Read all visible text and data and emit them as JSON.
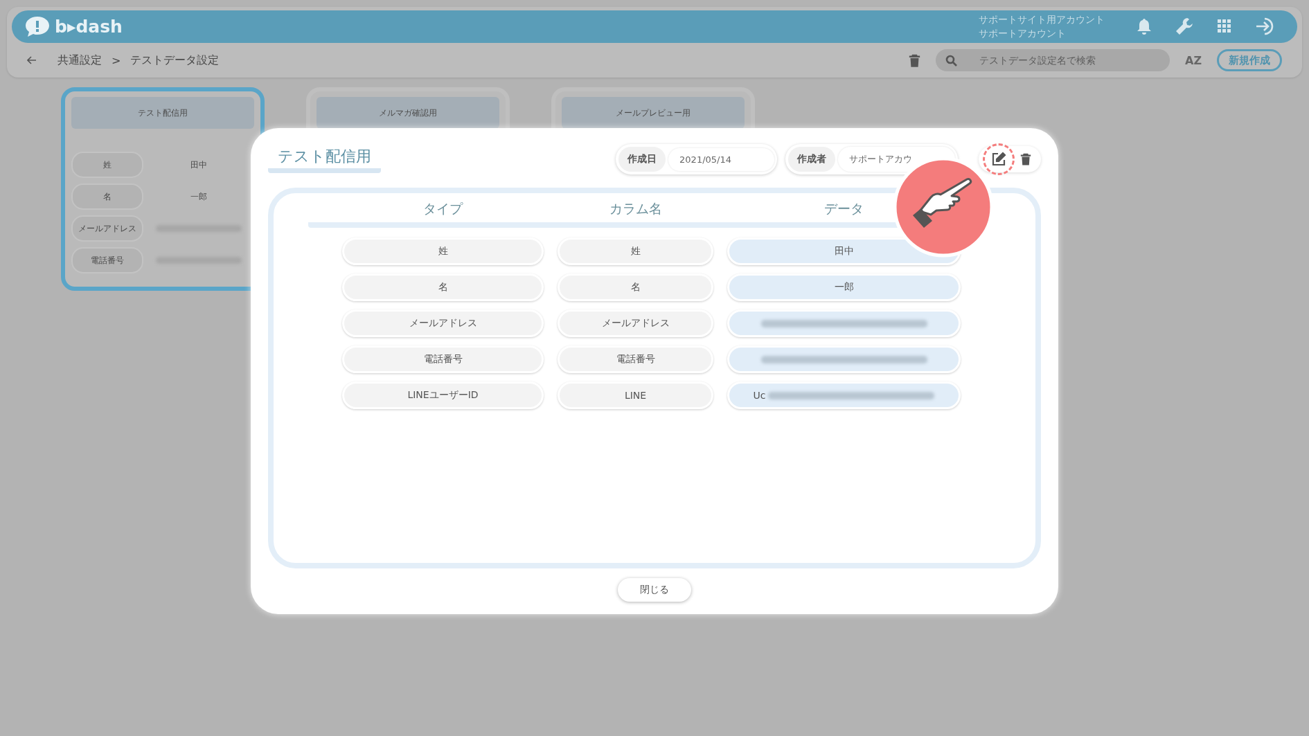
{
  "header": {
    "logo": "b▸dash",
    "account_site": "サポートサイト用アカウント",
    "account_user": "サポートアカウント"
  },
  "toolbar": {
    "breadcrumb": [
      "共通設定",
      "テストデータ設定"
    ],
    "separator": ">",
    "search": {
      "placeholder": "テストデータ設定名で検索"
    },
    "sort": "AZ",
    "new_button": "新規作成"
  },
  "cards": [
    {
      "title": "テスト配信用",
      "selected": true,
      "rows": [
        {
          "label": "姓",
          "value": "田中",
          "redacted": false
        },
        {
          "label": "名",
          "value": "一郎",
          "redacted": false
        },
        {
          "label": "メールアドレス",
          "redacted": true
        },
        {
          "label": "電話番号",
          "redacted": true
        }
      ]
    },
    {
      "title": "メルマガ確認用",
      "selected": false
    },
    {
      "title": "メールプレビュー用",
      "selected": false
    }
  ],
  "modal": {
    "title": "テスト配信用",
    "meta": [
      {
        "label": "作成日",
        "value": "2021/05/14"
      },
      {
        "label": "作成者",
        "value": "サポートアカウ"
      }
    ],
    "columns": [
      "タイプ",
      "カラム名",
      "データ"
    ],
    "rows": [
      {
        "type": "姓",
        "column": "姓",
        "data": "田中",
        "redacted": false
      },
      {
        "type": "名",
        "column": "名",
        "data": "一郎",
        "redacted": false
      },
      {
        "type": "メールアドレス",
        "column": "メールアドレス",
        "redacted": true
      },
      {
        "type": "電話番号",
        "column": "電話番号",
        "redacted": true
      },
      {
        "type": "LINEユーザーID",
        "column": "LINE",
        "data": "Uc",
        "redacted": true
      }
    ],
    "close_button": "閉じる"
  }
}
